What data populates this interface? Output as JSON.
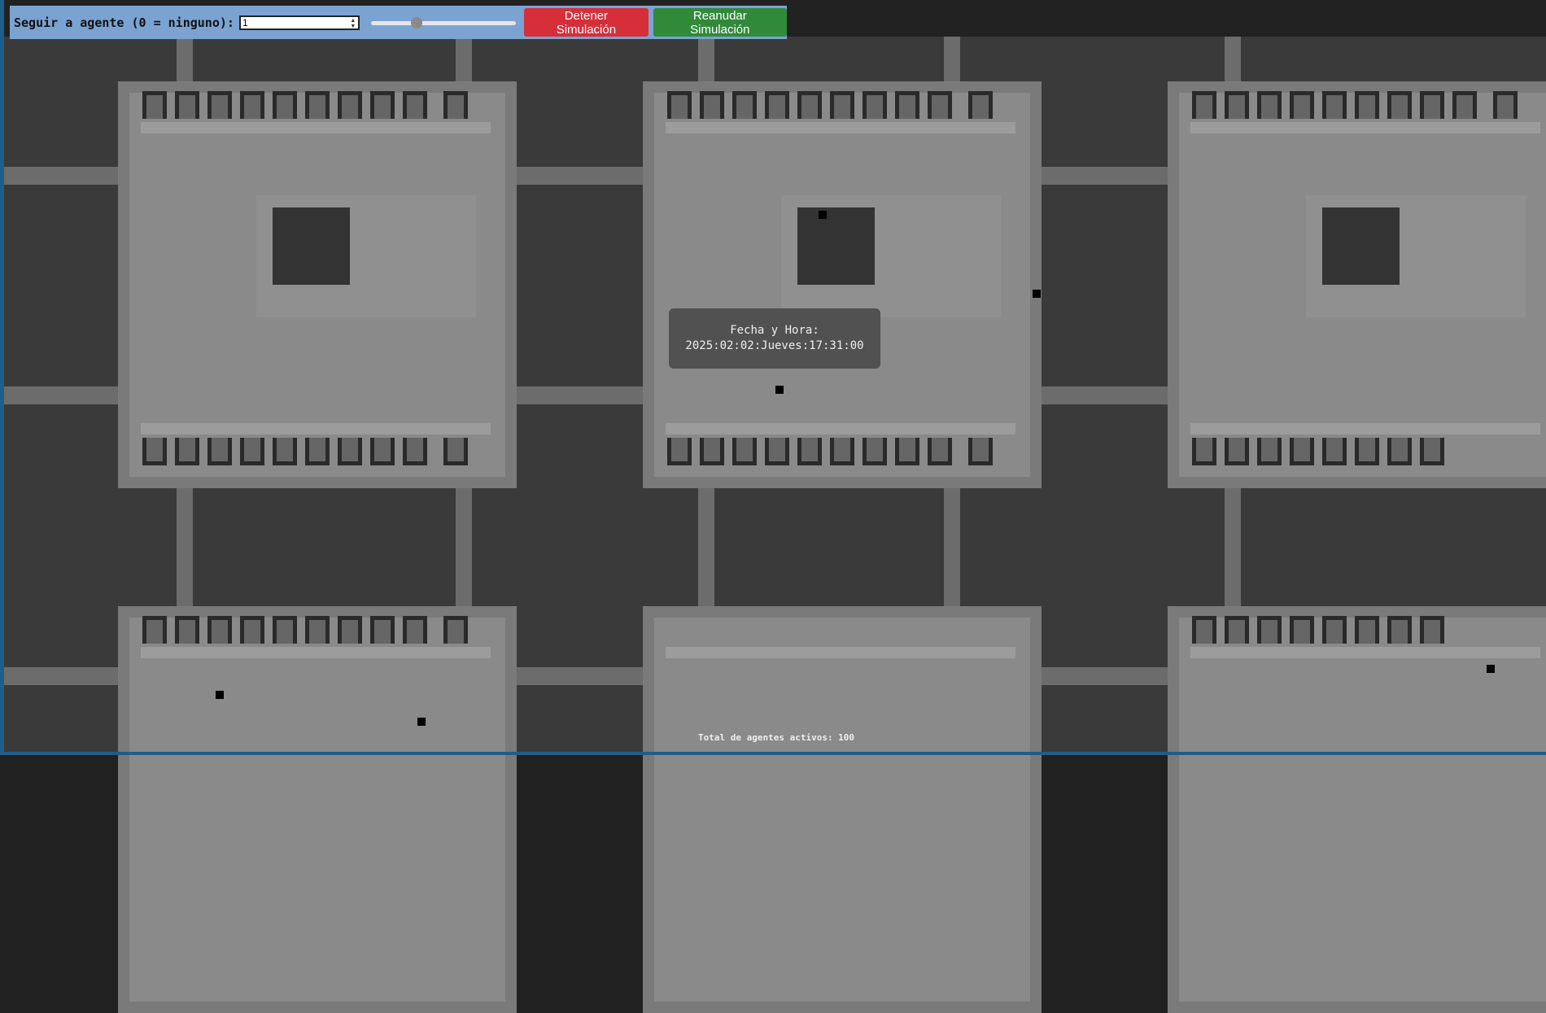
{
  "controls": {
    "follow_label": "Seguir a agente (0 = ninguno):",
    "agent_value": "1",
    "speed_level": 0.3,
    "stop_label": "Detener Simulación",
    "resume_label": "Reanudar Simulación",
    "stop_color": "#d62f3a",
    "resume_color": "#318a3a",
    "bar_color": "#7ba3d2"
  },
  "overlay": {
    "datetime_label": "Fecha y Hora:",
    "datetime_value": "2025:02:02:Jueves:17:31:00"
  },
  "footer": {
    "total_agents_text": "Total de agentes activos: 100"
  }
}
